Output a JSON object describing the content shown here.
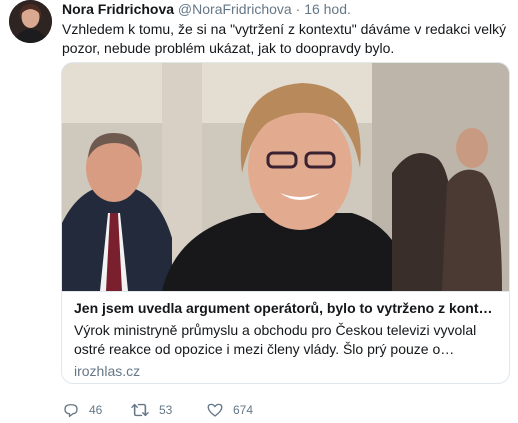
{
  "tweet": {
    "author_name": "Nora Fridrichova",
    "author_handle": "@NoraFridrichova",
    "separator": "·",
    "time": "16 hod.",
    "text": "Vzhledem k tomu, že si na \"vytržení z kontextu\" dáváme v redakci velký pozor, nebude problém ukázat, jak to doopravdy bylo."
  },
  "card": {
    "title": "Jen jsem uvedla argument operátorů, bylo to vytrženo z kontext…",
    "description": "Výrok ministryně průmyslu a obchodu pro Českou televizi vyvolal ostré reakce od opozice i mezi členy vlády. Šlo prý pouze o argument operá…",
    "domain": "irozhlas.cz"
  },
  "actions": {
    "reply_count": "46",
    "retweet_count": "53",
    "like_count": "674"
  },
  "icons": {
    "reply": "reply-icon",
    "retweet": "retweet-icon",
    "like": "heart-icon"
  },
  "colors": {
    "text": "#14171a",
    "muted": "#657786",
    "border": "#e1e8ed"
  }
}
